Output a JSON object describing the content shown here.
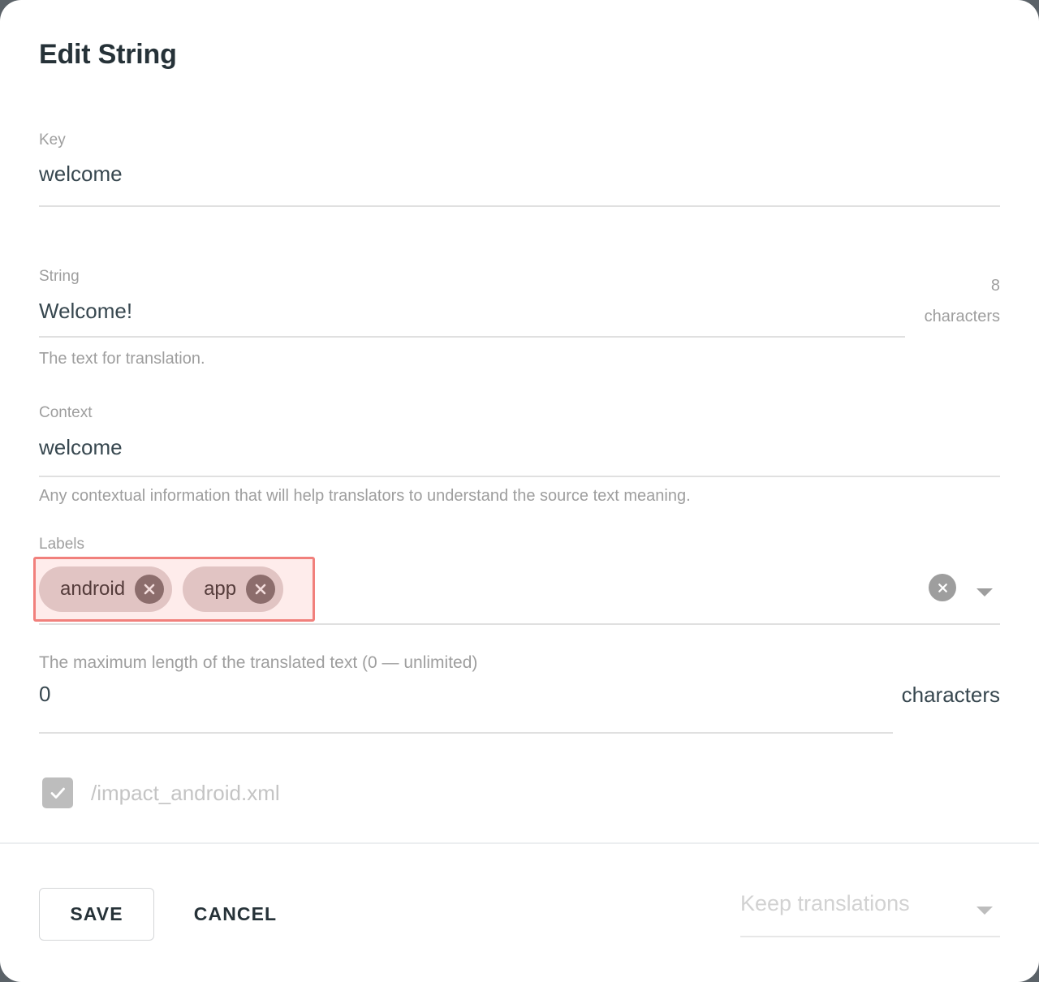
{
  "dialog": {
    "title": "Edit String"
  },
  "key_field": {
    "label": "Key",
    "value": "welcome"
  },
  "string_field": {
    "label": "String",
    "value": "Welcome!",
    "helper": "The text for translation.",
    "counter_number": "8",
    "counter_unit": "characters"
  },
  "context_field": {
    "label": "Context",
    "value": "welcome",
    "helper": "Any contextual information that will help translators to understand the source text meaning."
  },
  "labels_field": {
    "label": "Labels",
    "chips": [
      {
        "text": "android",
        "remove_icon": "close-circle-icon"
      },
      {
        "text": "app",
        "remove_icon": "close-circle-icon"
      }
    ],
    "clear_all_icon": "clear-all-circle-icon",
    "dropdown_icon": "chevron-down-icon"
  },
  "max_length_field": {
    "label": "The maximum length of the translated text (0 — unlimited)",
    "value": "0",
    "unit": "characters"
  },
  "file_row": {
    "checkbox_icon": "checkmark-icon",
    "checked": true,
    "file_name": "/impact_android.xml"
  },
  "footer": {
    "save_label": "SAVE",
    "cancel_label": "CANCEL",
    "keep_translations_placeholder": "Keep translations",
    "keep_translations_caret": "chevron-down-icon"
  },
  "colors": {
    "title_text": "#263238",
    "label_text": "#9e9e9e",
    "value_text": "#37474f",
    "underline": "#e0e0e0",
    "chip_bg": "#ded2d2",
    "chip_close_bg": "#7d6e6e",
    "highlight_border": "#f1807c",
    "checkbox_bg": "#bdbdbd",
    "backdrop": "#5b6268"
  }
}
